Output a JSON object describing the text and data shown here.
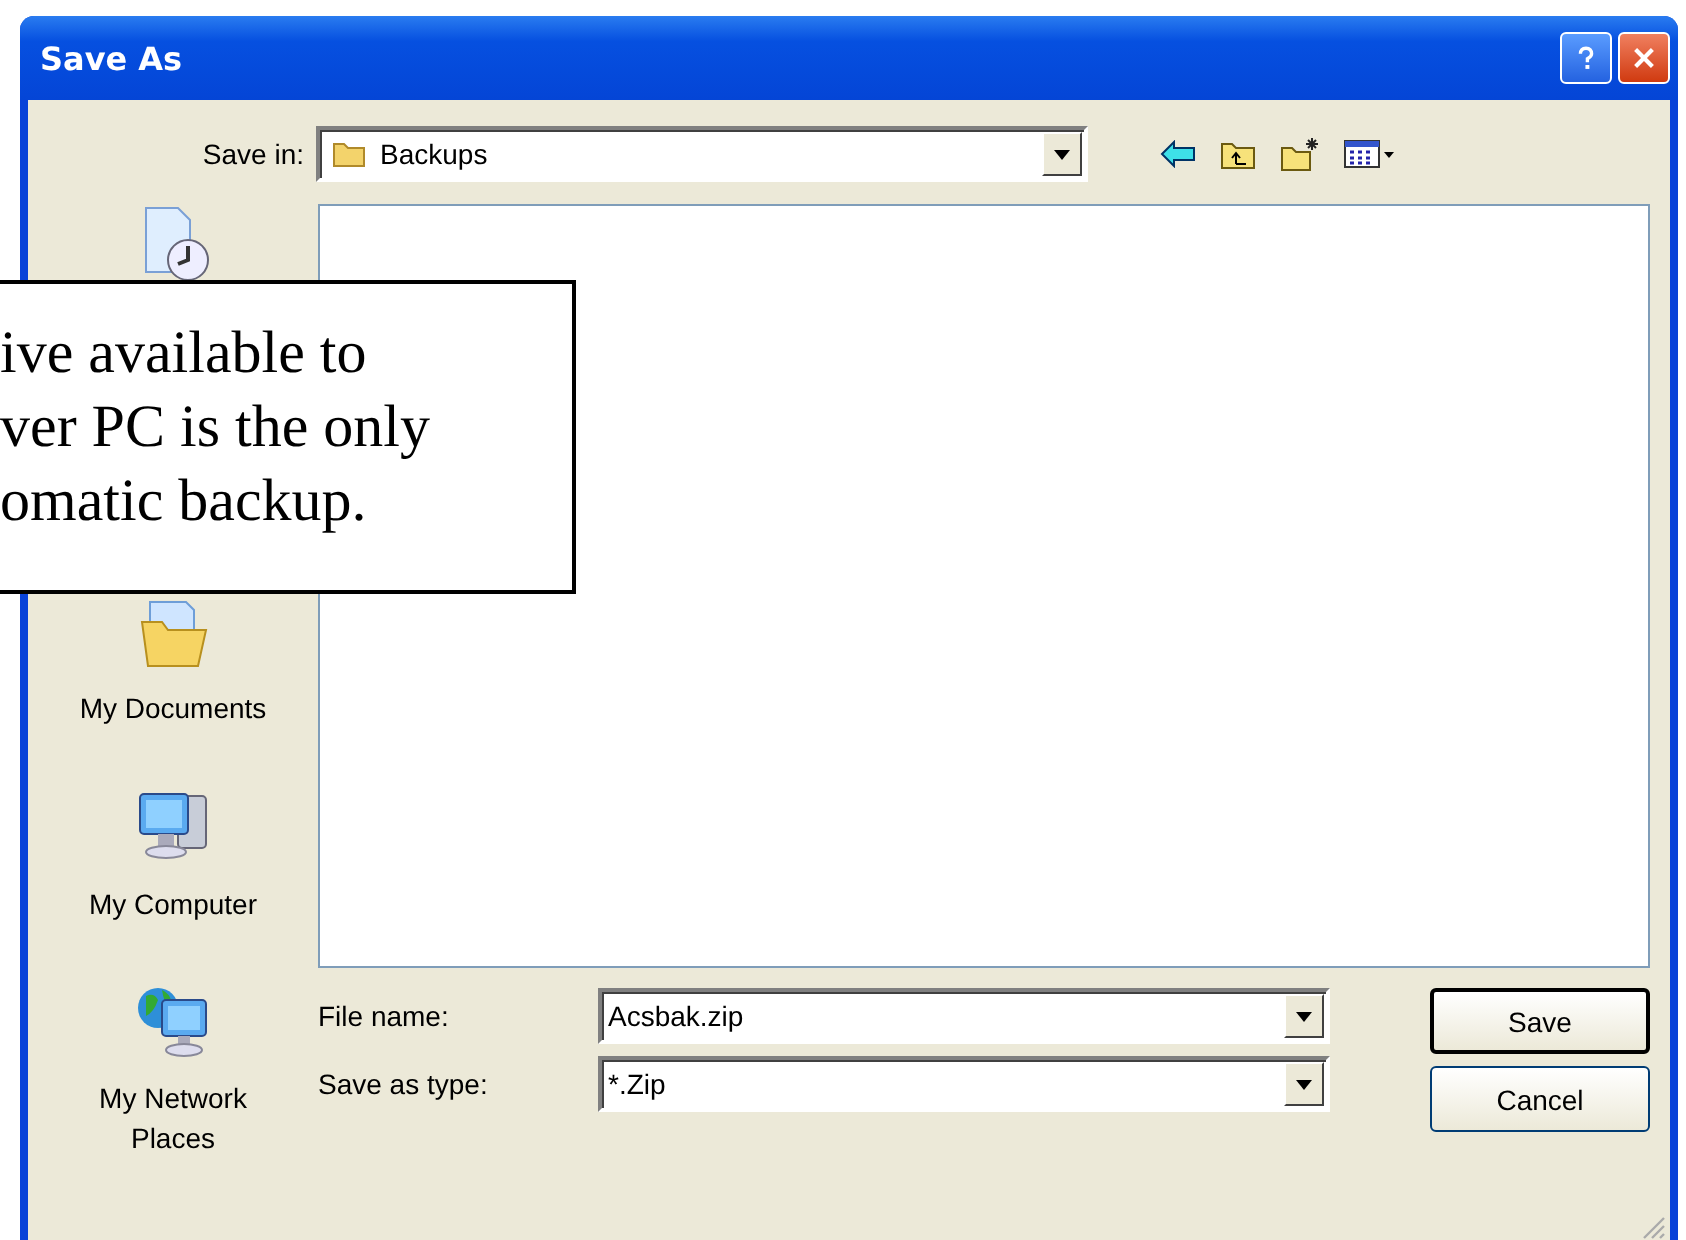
{
  "window": {
    "title": "Save As"
  },
  "save_in": {
    "label": "Save in:",
    "value": "Backups"
  },
  "places": [
    {
      "label": "My Documents",
      "kind": "documents"
    },
    {
      "label": "My Computer",
      "kind": "computer"
    },
    {
      "label": "My Network Places",
      "kind": "network"
    }
  ],
  "file_name": {
    "label": "File name:",
    "value": "Acsbak.zip"
  },
  "save_as_type": {
    "label": "Save as type:",
    "value": "*.Zip"
  },
  "buttons": [
    {
      "label": "Save",
      "default": true
    },
    {
      "label": "Cancel",
      "default": false
    }
  ],
  "callout": {
    "lines": [
      "ive available to",
      "ver PC is the only",
      "omatic backup."
    ]
  }
}
